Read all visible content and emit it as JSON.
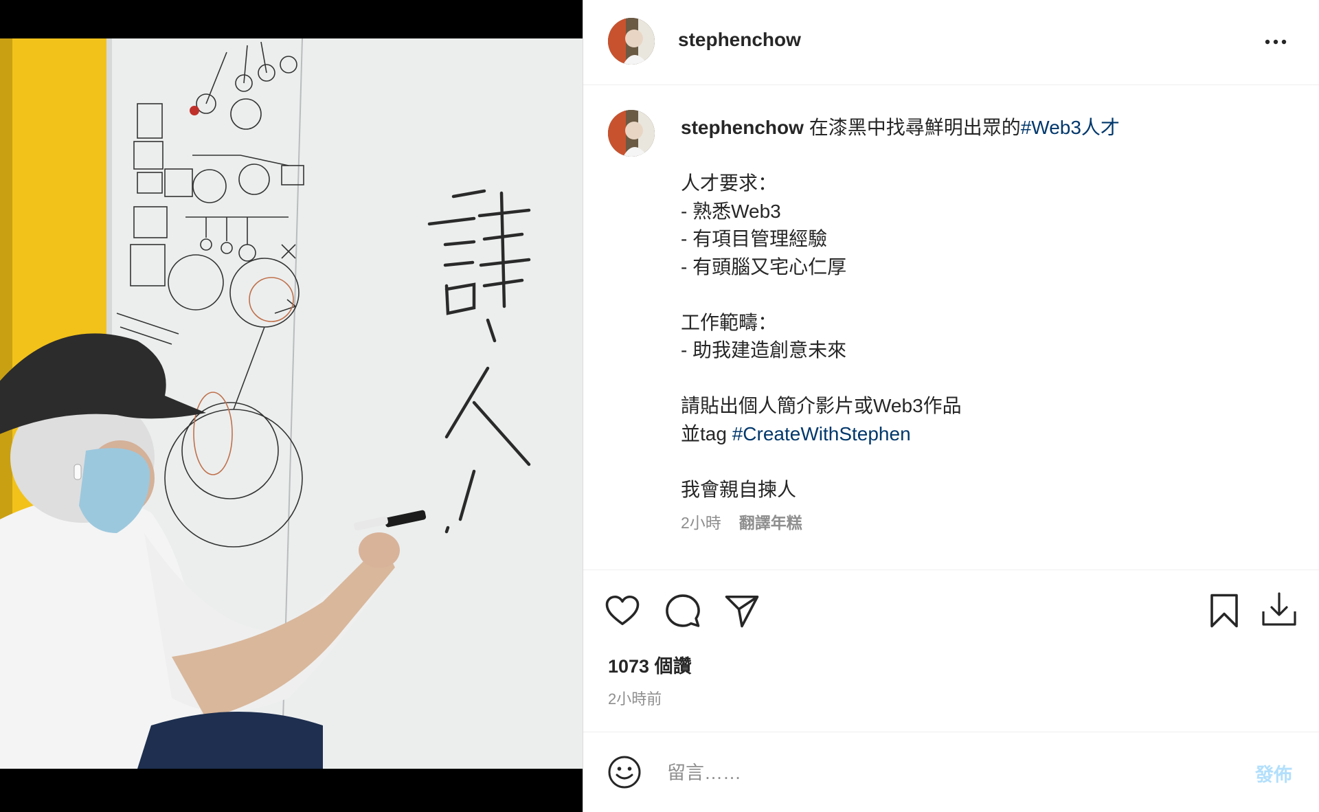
{
  "post": {
    "username": "stephenchow",
    "caption": {
      "author": "stephenchow",
      "first_line_text": " 在漆黑中找尋鮮明出眾的",
      "first_line_hashtag": "#Web3人才",
      "lines": [
        "",
        "人才要求：",
        "- 熟悉Web3",
        "- 有項目管理經驗",
        "- 有頭腦又宅心仁厚",
        "",
        "工作範疇：",
        "- 助我建造創意未來",
        "",
        "請貼出個人簡介影片或Web3作品"
      ],
      "tag_line_prefix": "並tag ",
      "tag_line_hashtag": "#CreateWithStephen",
      "closing_lines": [
        "",
        "我會親自揀人"
      ]
    },
    "caption_time": "2小時",
    "translate_label": "翻譯年糕",
    "likes": "1073 個讚",
    "time_ago": "2小時前",
    "whiteboard_text": "請人！"
  },
  "comment": {
    "placeholder": "留言……",
    "post_label": "發佈"
  },
  "icons": {
    "more": "more-options-icon",
    "like": "heart-icon",
    "comment": "comment-icon",
    "share": "paper-plane-icon",
    "save": "bookmark-icon",
    "download": "download-icon",
    "emoji": "emoji-icon"
  },
  "colors": {
    "hashtag": "#00376b",
    "post_button_disabled": "#b2dffc",
    "muted_text": "#8e8e8e"
  }
}
